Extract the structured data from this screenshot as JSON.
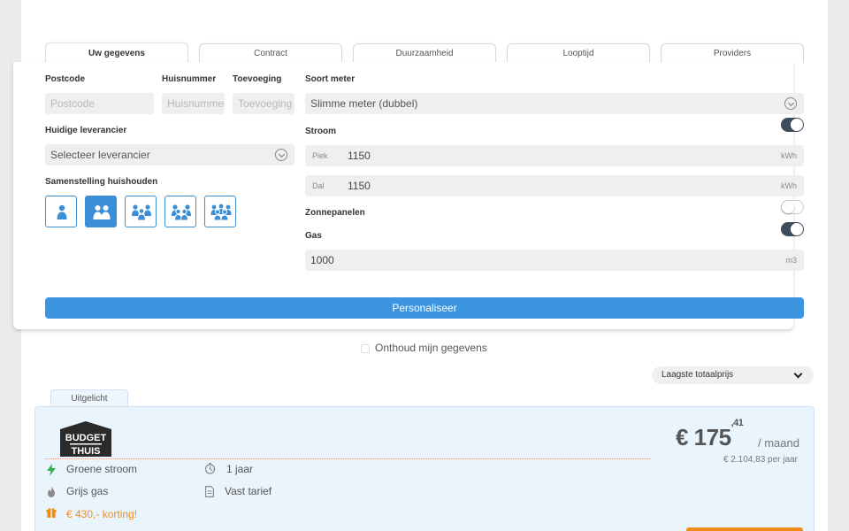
{
  "tabs": [
    {
      "label": "Uw gegevens"
    },
    {
      "label": "Contract"
    },
    {
      "label": "Duurzaamheid"
    },
    {
      "label": "Looptijd"
    },
    {
      "label": "Providers"
    }
  ],
  "form": {
    "postcode": {
      "label": "Postcode",
      "placeholder": "Postcode"
    },
    "huisnummer": {
      "label": "Huisnummer",
      "placeholder": "Huisnummer"
    },
    "toevoeging": {
      "label": "Toevoeging",
      "placeholder": "Toevoeging"
    },
    "leverancier": {
      "label": "Huidige leverancier",
      "value": "Selecteer leverancier"
    },
    "household": {
      "label": "Samenstelling huishouden",
      "selected_size": 2,
      "options": [
        1,
        2,
        3,
        4,
        5
      ]
    },
    "meter": {
      "label": "Soort meter",
      "value": "Slimme meter (dubbel)"
    },
    "stroom": {
      "label": "Stroom",
      "enabled": true,
      "piek": {
        "prefix": "Piek",
        "value": "1150",
        "unit": "kWh"
      },
      "dal": {
        "prefix": "Dal",
        "value": "1150",
        "unit": "kWh"
      }
    },
    "zonnepanelen": {
      "label": "Zonnepanelen",
      "enabled": false
    },
    "gas": {
      "label": "Gas",
      "enabled": true,
      "value": "1000",
      "unit": "m3"
    },
    "submit_label": "Personaliseer"
  },
  "remember_label": "Onthoud mijn gegevens",
  "sort": {
    "value": "Laagste totaalprijs"
  },
  "featured": {
    "tab_label": "Uitgelicht",
    "logo": {
      "line1": "BUDGET",
      "line2": "THUIS"
    },
    "features": {
      "stroom": "Groene stroom",
      "gas": "Grijs gas",
      "korting": "€ 430,- korting!",
      "looptijd": "1 jaar",
      "tarief": "Vast tarief"
    },
    "price": {
      "main": "€ 175",
      "cents": ",41",
      "per": "/ maand",
      "yearly": "€ 2.104,83 per jaar"
    }
  },
  "colors": {
    "primary": "#3b96df",
    "toggle_on": "#3e4d5c",
    "accent_orange": "#f28c18",
    "lightning_green": "#2fb24c",
    "card_bg": "#eaf4fd"
  }
}
